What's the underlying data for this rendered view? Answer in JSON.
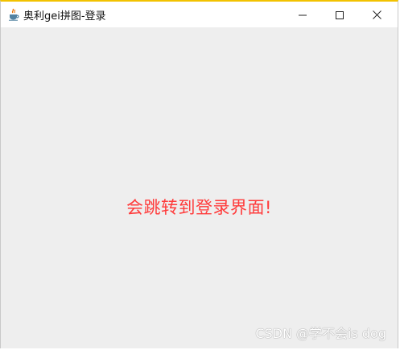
{
  "window": {
    "title": "奥利gei拼图-登录",
    "icons": {
      "app": "java-cup-icon",
      "minimize": "minimize-icon",
      "maximize": "maximize-icon",
      "close": "close-icon"
    }
  },
  "content": {
    "message": "会跳转到登录界面!",
    "message_color": "#ff3b3b",
    "background_color": "#eeeeee"
  },
  "watermark": {
    "text": "CSDN @学不会is dog"
  }
}
